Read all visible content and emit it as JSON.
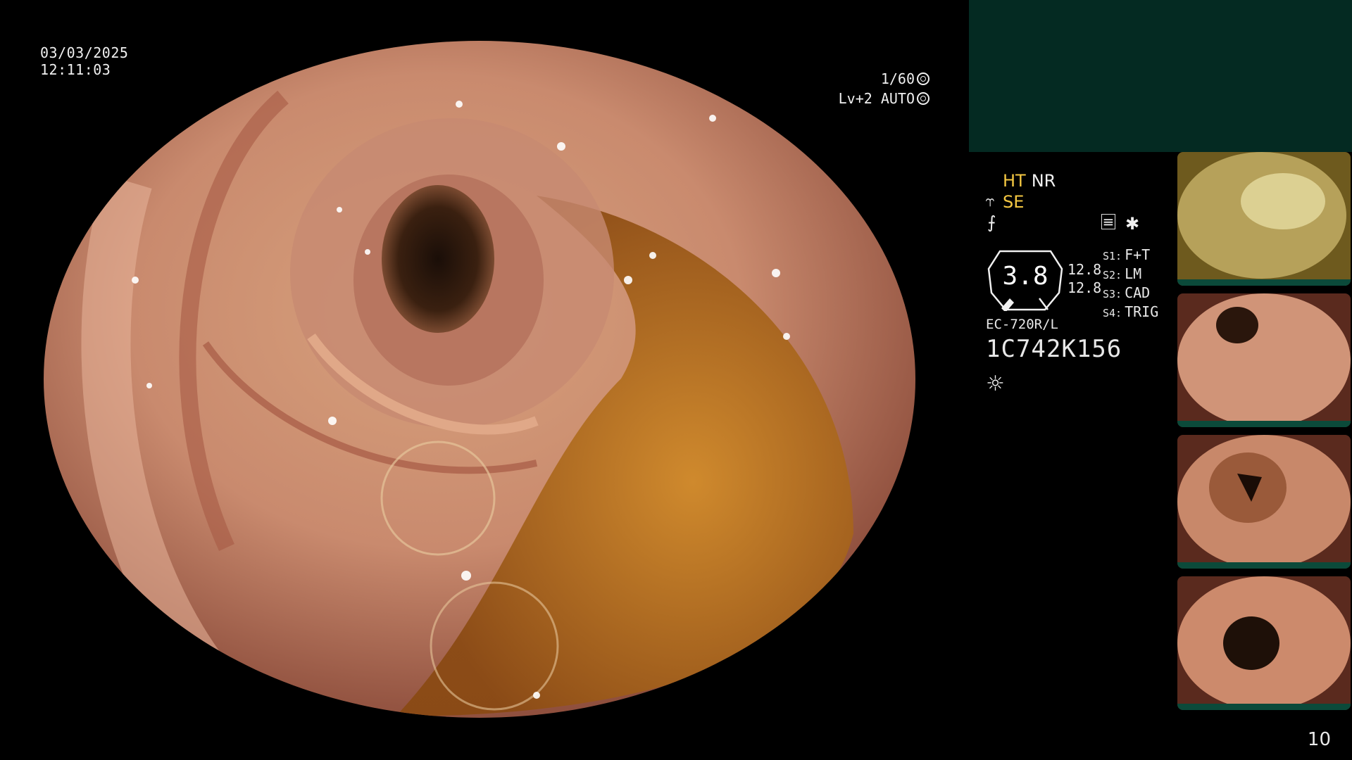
{
  "overlay": {
    "date": "03/03/2025",
    "time": "12:11:03",
    "shutter": "1/60",
    "level": "Lv+2 AUTO"
  },
  "modes": {
    "ht": "HT",
    "nr": "NR",
    "se": "SE"
  },
  "gauge": {
    "value": "3.8",
    "top_num": "12.8",
    "bottom_num": "12.8"
  },
  "slots": [
    {
      "key": "S1:",
      "value": "F+T"
    },
    {
      "key": "S2:",
      "value": "LM"
    },
    {
      "key": "S3:",
      "value": "CAD"
    },
    {
      "key": "S4:",
      "value": "TRIG"
    }
  ],
  "scope_model": "EC-720R/L",
  "scope_serial": "1C742K156",
  "page_number": "10",
  "colors": {
    "mode_accent": "#f5c842",
    "status_panel": "#042a22",
    "tissue": "#c98a6e",
    "fluid": "#b87a1a"
  }
}
